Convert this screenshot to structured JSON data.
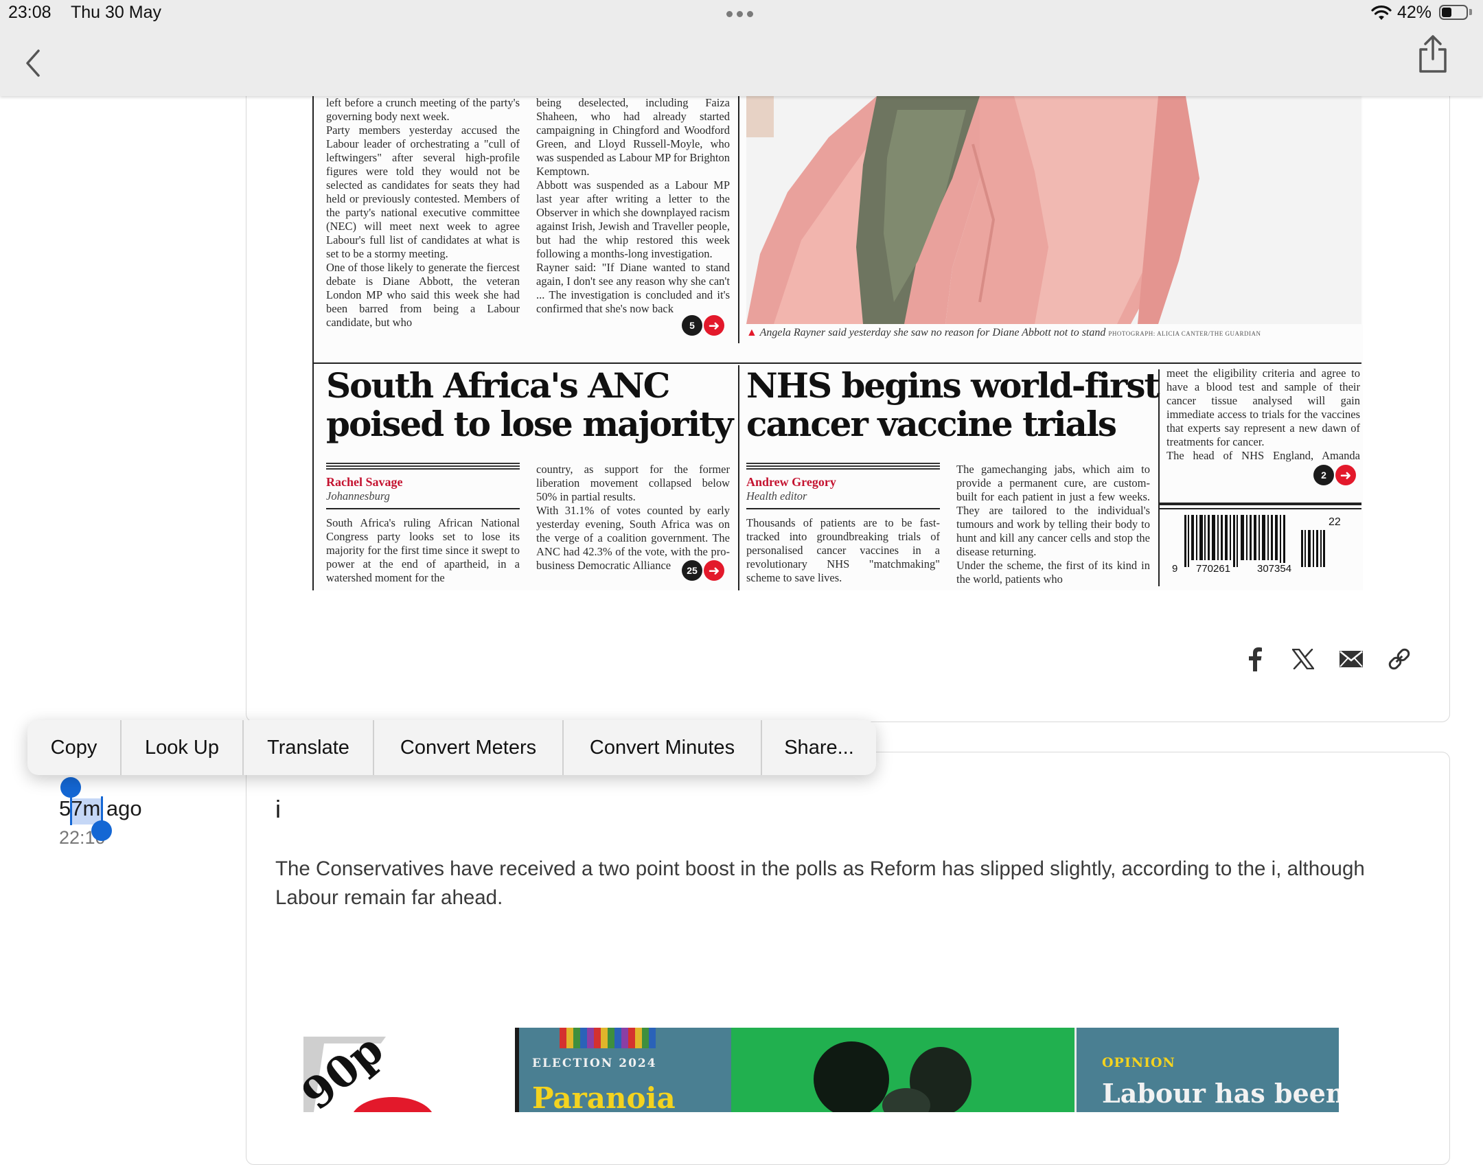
{
  "status_bar": {
    "time": "23:08",
    "date": "Thu 30 May",
    "battery": "42%",
    "battery_level": 0.42,
    "icons": [
      "wifi-icon",
      "battery-icon"
    ]
  },
  "nav": {
    "back_icon": "chevron-left-icon",
    "share_icon": "share-icon"
  },
  "newspaper": {
    "top_col1": "left before a crunch meeting of the party's governing body next week.\n   Party members yesterday accused the Labour leader of orchestrating a \"cull of leftwingers\" after several high-profile figures were told they would not be selected as candidates for seats they had held or previously contested. Members of the party's national executive committee (NEC) will meet next week to agree Labour's full list of candidates at what is set to be a stormy meeting.\n   One of those likely to generate the fiercest debate is Diane Abbott, the veteran London MP who said this week she had been barred from being a Labour candidate, but who",
    "top_col2": "being deselected, including Faiza Shaheen, who had already started campaigning in Chingford and Woodford Green, and Lloyd Russell-Moyle, who was suspended as Labour MP for Brighton Kemptown.\n   Abbott was suspended as a Labour MP last year after writing a letter to the Observer in which she downplayed racism against Irish, Jewish and Traveller people, but had the whip restored this week following a months-long investigation.\n   Rayner said: \"If Diane wanted to stand again, I don't see any reason why she can't ... The investigation is concluded and it's confirmed that she's now back",
    "top_col2_page": "5",
    "photo_caption": "Angela Rayner said yesterday she saw no reason for Diane Abbott not to stand",
    "photo_credit": "PHOTOGRAPH: ALICIA CANTER/THE GUARDIAN",
    "anc": {
      "headline": "South Africa's ANC poised to lose majority",
      "byline": "Rachel Savage",
      "dateline": "Johannesburg",
      "col1": "South Africa's ruling African National Congress party looks set to lose its majority for the first time since it swept to power at the end of apartheid, in a watershed moment for the",
      "col2": "country, as support for the former liberation movement collapsed below 50% in partial results.\n   With 31.1% of votes counted by early yesterday evening, South Africa was on the verge of a coalition government. The ANC had 42.3% of the vote, with the pro-business Democratic Alliance",
      "page": "25"
    },
    "nhs": {
      "headline": "NHS begins world-first cancer vaccine trials",
      "byline": "Andrew Gregory",
      "role": "Health editor",
      "col1": "Thousands of patients are to be fast-tracked into groundbreaking trials of personalised cancer vaccines in a revolutionary NHS \"matchmaking\" scheme to save lives.",
      "col2": "   The gamechanging jabs, which aim to provide a permanent cure, are custom-built for each patient in just a few weeks. They are tailored to the individual's tumours and work by telling their body to hunt and kill any cancer cells and stop the disease returning.\n   Under the scheme, the first of its kind in the world, patients who",
      "col3": "meet the eligibility criteria and agree to have a blood test and sample of their cancer tissue analysed will gain immediate access to trials for the vaccines that experts say represent a new dawn of treatments for cancer.\n   The head of NHS England, Amanda Pritchard, hailed the development as a \"landmark",
      "page": "2"
    },
    "barcode": {
      "issue": "22",
      "digit": "9",
      "group1": "770261",
      "group2": "307354"
    }
  },
  "share_row": {
    "icons": [
      "facebook-icon",
      "x-icon",
      "mail-icon",
      "link-icon"
    ]
  },
  "context_menu": {
    "items": [
      "Copy",
      "Look Up",
      "Translate",
      "Convert Meters",
      "Convert Minutes",
      "Share..."
    ]
  },
  "entry": {
    "time_ago": "57m ago",
    "time_clock": "22:10",
    "title": "i",
    "body": "The Conservatives have received a two point boost in the polls as Reform has slipped slightly, according to the i, although Labour remain far ahead."
  },
  "front_pages": {
    "price": "90p",
    "election_tag": "ELECTION 2024",
    "headline_left": "Paranoia",
    "opinion_tag": "OPINION",
    "opinion_headline": "Labour has been"
  },
  "colors": {
    "selection": "#1467d4",
    "guardian_red": "#c4122f",
    "menu_bg": "#f3f3f3",
    "topbar_bg": "#ececec"
  }
}
